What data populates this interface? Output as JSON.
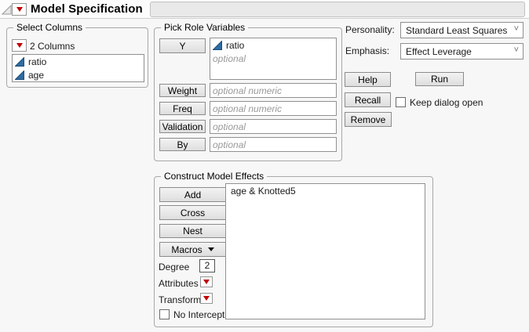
{
  "header": {
    "title": "Model Specification",
    "disclosure_icon": "open-triangle",
    "menu_icon": "red-triangle"
  },
  "select_columns": {
    "legend": "Select Columns",
    "count_label": "2 Columns",
    "columns": [
      {
        "name": "ratio",
        "icon": "continuous-blue-triangle"
      },
      {
        "name": "age",
        "icon": "continuous-blue-triangle"
      }
    ]
  },
  "pick_roles": {
    "legend": "Pick Role Variables",
    "y_button": "Y",
    "y_items": [
      {
        "name": "ratio",
        "icon": "continuous-blue-triangle"
      }
    ],
    "y_placeholder": "optional",
    "roles": [
      {
        "button": "Weight",
        "placeholder": "optional numeric"
      },
      {
        "button": "Freq",
        "placeholder": "optional numeric"
      },
      {
        "button": "Validation",
        "placeholder": "optional"
      },
      {
        "button": "By",
        "placeholder": "optional"
      }
    ]
  },
  "options": {
    "personality_label": "Personality:",
    "personality_value": "Standard Least Squares",
    "emphasis_label": "Emphasis:",
    "emphasis_value": "Effect Leverage",
    "help_label": "Help",
    "run_label": "Run",
    "recall_label": "Recall",
    "remove_label": "Remove",
    "keep_dialog_label": "Keep dialog open",
    "keep_dialog_checked": false
  },
  "effects": {
    "legend": "Construct Model Effects",
    "add_label": "Add",
    "cross_label": "Cross",
    "nest_label": "Nest",
    "macros_label": "Macros",
    "degree_label": "Degree",
    "degree_value": "2",
    "attributes_label": "Attributes",
    "transform_label": "Transform",
    "no_intercept_label": "No Intercept",
    "no_intercept_checked": false,
    "items": [
      "age & Knotted5"
    ]
  },
  "icons": {
    "red_triangle_color": "#c00000",
    "continuous_blue": "#2e6da4",
    "dropdown_chevron": "˅"
  }
}
